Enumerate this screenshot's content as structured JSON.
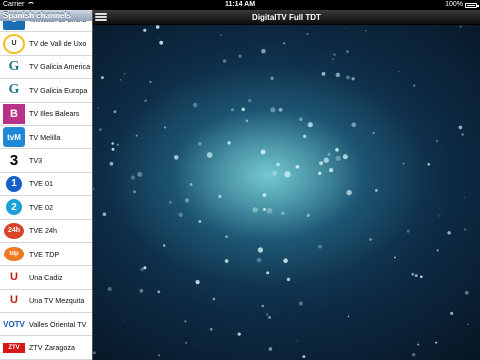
{
  "status_bar": {
    "carrier": "Carrier",
    "time": "11:14 AM",
    "battery": "100%"
  },
  "sidebar": {
    "header": "Spanish channels",
    "channels": [
      {
        "name": "Television de Girona",
        "logo": "G",
        "logo_class": "l-girona"
      },
      {
        "name": "TV de Vall de Uxo",
        "logo": "U",
        "logo_class": "l-uxo"
      },
      {
        "name": "TV Galicia America",
        "logo": "G",
        "logo_class": "l-galicia"
      },
      {
        "name": "TV Galicia Europa",
        "logo": "G",
        "logo_class": "l-galicia"
      },
      {
        "name": "TV Illes Balears",
        "logo": "B",
        "logo_class": "l-balears"
      },
      {
        "name": "TV Melilla",
        "logo": "tvM",
        "logo_class": "l-melilla"
      },
      {
        "name": "TV3",
        "logo": "3",
        "logo_class": "l-tv3"
      },
      {
        "name": "TVE 01",
        "logo": "1",
        "logo_class": "l-1"
      },
      {
        "name": "TVE 02",
        "logo": "2",
        "logo_class": "l-2"
      },
      {
        "name": "TVE 24h",
        "logo": "24h",
        "logo_class": "l-24"
      },
      {
        "name": "TVE TDP",
        "logo": "tdp",
        "logo_class": "l-tdp"
      },
      {
        "name": "Una Cadiz",
        "logo": "U",
        "logo_class": "l-cadiz"
      },
      {
        "name": "Una TV Mezquita",
        "logo": "U",
        "logo_class": "l-mezquita"
      },
      {
        "name": "Valles Oriental TV",
        "logo": "VOTV",
        "logo_class": "l-valles"
      },
      {
        "name": "ZTV Zaragoza",
        "logo": "ZTV",
        "logo_class": "l-ztv"
      }
    ]
  },
  "navbar": {
    "title": "DigitalTV Full TDT",
    "menu_icon": "menu-icon"
  },
  "colors": {
    "sidebar_header": "#8fa1b8",
    "navbar": "#1a1a1a",
    "glow": "#82dce1"
  }
}
